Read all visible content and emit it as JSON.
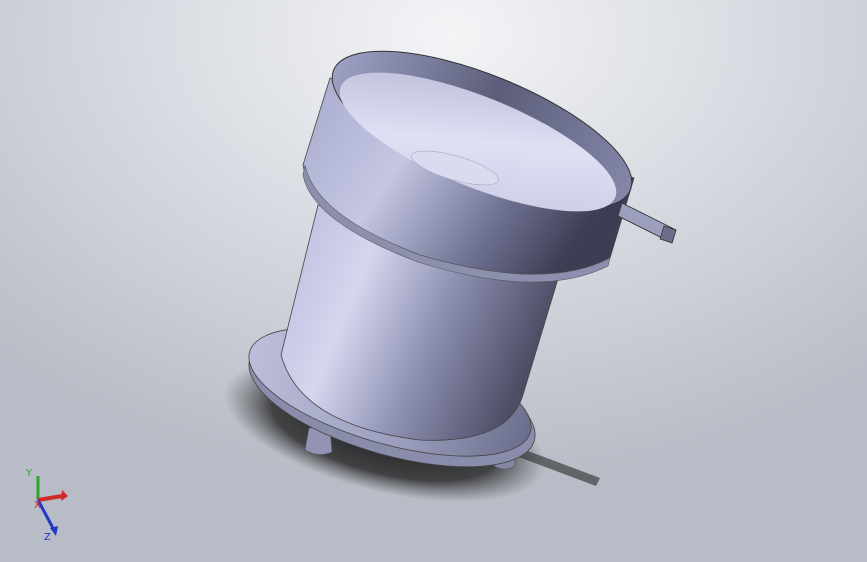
{
  "viewport": {
    "background_top": "#f3f4f6",
    "background_bottom": "#b7bcc6"
  },
  "model": {
    "name": "",
    "body_color": "#a9abc8",
    "shadow_color": "#1a1a1a"
  },
  "triad": {
    "x_label": "X",
    "y_label": "Y",
    "z_label": "Z",
    "x_color": "#d12a2a",
    "y_color": "#2fa52f",
    "z_color": "#2236c8"
  }
}
